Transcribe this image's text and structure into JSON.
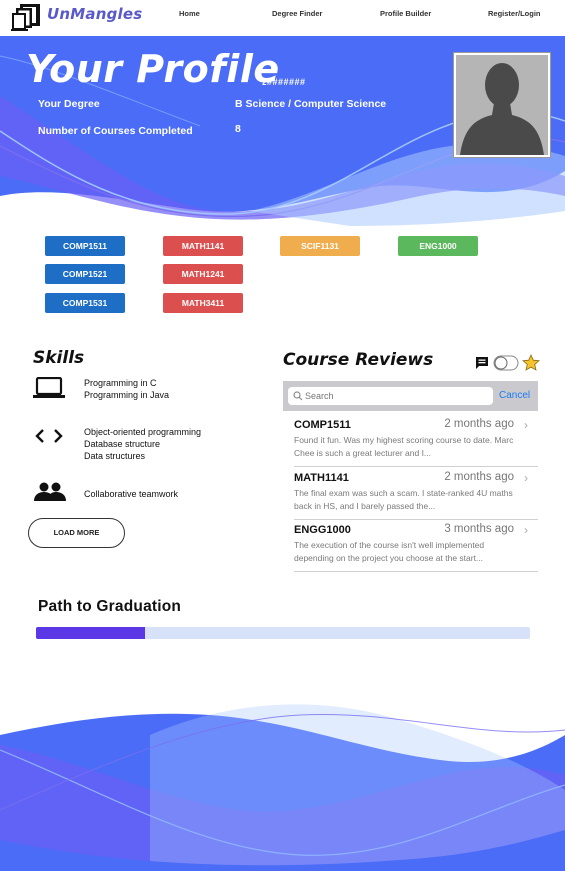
{
  "brand": {
    "name": "UnMangles"
  },
  "nav": {
    "links": [
      "Home",
      "Degree Finder",
      "Profile Builder",
      "Register/Login"
    ]
  },
  "profile": {
    "title": "Your Profile",
    "zid": "z#######",
    "degree_label": "Your Degree",
    "degree_value": "B Science / Computer Science",
    "courses_label": "Number of Courses Completed",
    "courses_value": "8"
  },
  "courses": [
    {
      "code": "COMP1511",
      "color": "#1d6ec4"
    },
    {
      "code": "COMP1521",
      "color": "#1d6ec4"
    },
    {
      "code": "COMP1531",
      "color": "#1d6ec4"
    },
    {
      "code": "MATH1141",
      "color": "#dc4f4f"
    },
    {
      "code": "MATH1241",
      "color": "#dc4f4f"
    },
    {
      "code": "MATH3411",
      "color": "#dc4f4f"
    },
    {
      "code": "SCIF1131",
      "color": "#f0ad4e"
    },
    {
      "code": "ENG1000",
      "color": "#5cb85c"
    }
  ],
  "skills": {
    "title": "Skills",
    "groups": [
      {
        "icon": "laptop-icon",
        "items": [
          "Programming in C",
          "Programming in Java"
        ]
      },
      {
        "icon": "code-icon",
        "items": [
          "Object-oriented programming",
          "Database structure",
          "Data structures"
        ]
      },
      {
        "icon": "people-icon",
        "items": [
          "Collaborative teamwork"
        ]
      }
    ],
    "load_more": "LOAD MORE"
  },
  "reviews": {
    "title": "Course Reviews",
    "search_placeholder": "Search",
    "cancel_label": "Cancel",
    "items": [
      {
        "code": "COMP1511",
        "time": "2 months ago",
        "text": "Found it fun. Was my highest scoring course to date. Marc Chee is such a great lecturer and I..."
      },
      {
        "code": "MATH1141",
        "time": "2 months ago",
        "text": "The final exam was such a scam. I state-ranked 4U maths back in HS, and I barely passed the..."
      },
      {
        "code": "ENGG1000",
        "time": "3 months ago",
        "text": "The execution of the course isn't well implemented depending on the project you choose at the start..."
      }
    ]
  },
  "graduation": {
    "title": "Path to Graduation",
    "progress": 0.22
  },
  "colors": {
    "accent": "#5a59c9",
    "hero": "#4a6cf7",
    "progress": "#5b37e6"
  }
}
